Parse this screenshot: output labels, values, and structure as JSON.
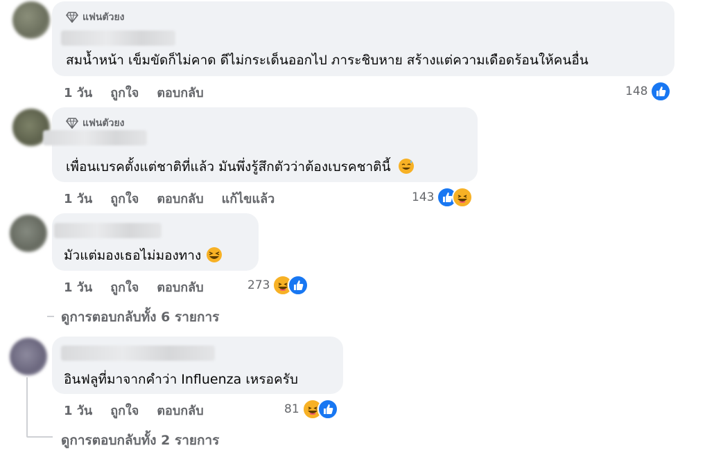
{
  "comments": [
    {
      "badge": "แฟนตัวยง",
      "text": "สมน้ำหน้า เข็มขัดก็ไม่คาด ดีไม่กระเด็นออกไป ภาระชิบหาย สร้างแต่ความเดือดร้อนให้คนอื่น",
      "time": "1 วัน",
      "like_label": "ถูกใจ",
      "reply_label": "ตอบกลับ",
      "reaction_count": "148",
      "reactions": [
        "like-icon"
      ]
    },
    {
      "badge": "แฟนตัวยง",
      "text": "เพื่อนเบรคตั้งแต่ชาติที่แล้ว มันพึ่งรู้สึกตัวว่าต้องเบรคชาตินี้",
      "emoji": "sweat-smile-emoji",
      "time": "1 วัน",
      "like_label": "ถูกใจ",
      "reply_label": "ตอบกลับ",
      "edited_label": "แก้ไขแล้ว",
      "reaction_count": "143",
      "reactions": [
        "like-icon",
        "haha-icon"
      ]
    },
    {
      "text": "มัวแต่มองเธอไม่มองทาง",
      "emoji": "laughing-emoji",
      "time": "1 วัน",
      "like_label": "ถูกใจ",
      "reply_label": "ตอบกลับ",
      "reaction_count": "273",
      "reactions": [
        "haha-icon",
        "like-icon"
      ]
    },
    {
      "text": "อินฟลูที่มาจากคำว่า Influenza เหรอครับ",
      "time": "1 วัน",
      "like_label": "ถูกใจ",
      "reply_label": "ตอบกลับ",
      "reaction_count": "81",
      "reactions": [
        "haha-icon",
        "like-icon"
      ]
    }
  ],
  "view_replies": [
    "ดูการตอบกลับทั้ง 6 รายการ",
    "ดูการตอบกลับทั้ง 2 รายการ"
  ],
  "colors": {
    "bubble": "#f0f2f5",
    "meta_text": "#65676b",
    "like_blue": "#1877f2",
    "haha_yellow": "#f7b125"
  }
}
